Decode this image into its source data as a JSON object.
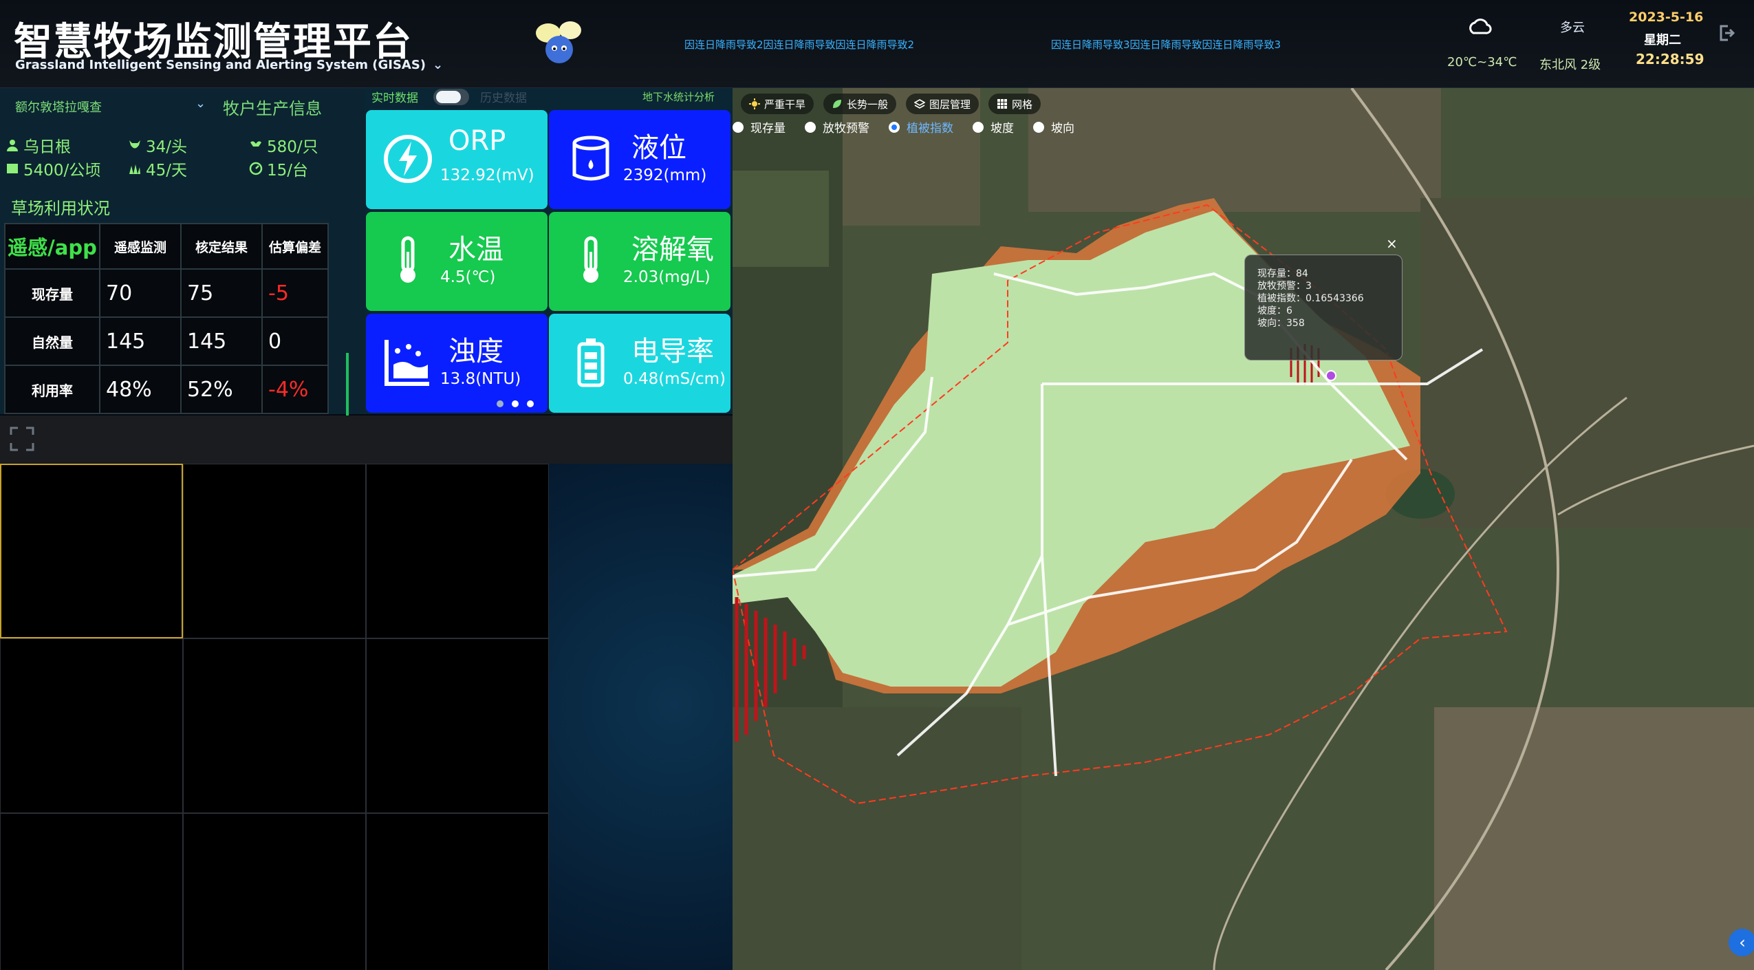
{
  "header": {
    "title": "智慧牧场监测管理平台",
    "subtitle": "Grassland Intelligent Sensing and Alerting System (GISAS)",
    "ticker": [
      "因连日降雨导致2因连日降雨导致因连日降雨导致2",
      "因连日降雨导致3因连日降雨导致因连日降雨导致3"
    ],
    "weather": {
      "icon": "cloud-icon",
      "condition": "多云",
      "temp": "20℃~34℃",
      "wind": "东北风 2级"
    },
    "date": "2023-5-16",
    "weekday": "星期二",
    "time": "22:28:59"
  },
  "left_panel": {
    "region": "额尔敦塔拉嘎查",
    "production_title": "牧户生产信息",
    "stats": {
      "herder": "乌日根",
      "cattle": "34/头",
      "sheep": "580/只",
      "area": "5400/公顷",
      "days": "45/天",
      "machines": "15/台"
    },
    "usage_title": "草场利用状况",
    "table": {
      "headers": [
        "遥感/app",
        "遥感监测",
        "核定结果",
        "估算偏差"
      ],
      "rows": [
        {
          "label": "现存量",
          "remote": "70",
          "verified": "75",
          "deviation": "-5"
        },
        {
          "label": "自然量",
          "remote": "145",
          "verified": "145",
          "deviation": "0"
        },
        {
          "label": "利用率",
          "remote": "48%",
          "verified": "52%",
          "deviation": "-4%"
        }
      ]
    }
  },
  "sensors": {
    "realtime_label": "实时数据",
    "history_label": "历史数据",
    "groundwater_link": "地下水统计分析",
    "cards": [
      {
        "name": "ORP",
        "value": "132.92(mV)",
        "icon": "bolt-icon",
        "color": "#1ad7df"
      },
      {
        "name": "液位",
        "value": "2392(mm)",
        "icon": "tank-icon",
        "color": "#0a1fff"
      },
      {
        "name": "水温",
        "value": "4.5(℃)",
        "icon": "thermometer-icon",
        "color": "#16c94f"
      },
      {
        "name": "溶解氧",
        "value": "2.03(mg/L)",
        "icon": "thermometer-icon",
        "color": "#16c94f"
      },
      {
        "name": "浊度",
        "value": "13.8(NTU)",
        "icon": "turbidity-icon",
        "color": "#0a1fff"
      },
      {
        "name": "电导率",
        "value": "0.48(mS/cm)",
        "icon": "battery-icon",
        "color": "#1ad7df"
      }
    ],
    "page_dots": 3,
    "active_dot": 2
  },
  "map": {
    "toolbar": [
      "严重干旱",
      "长势一般",
      "图层管理",
      "网格"
    ],
    "layers": [
      "现存量",
      "放牧预警",
      "植被指数",
      "坡度",
      "坡向"
    ],
    "active_layer": "植被指数",
    "popup": {
      "existing": "现存量：84",
      "grazing": "放牧预警：3",
      "ndvi": "植被指数：0.16543366",
      "slope": "坡度：6",
      "aspect": "坡向：358"
    }
  }
}
